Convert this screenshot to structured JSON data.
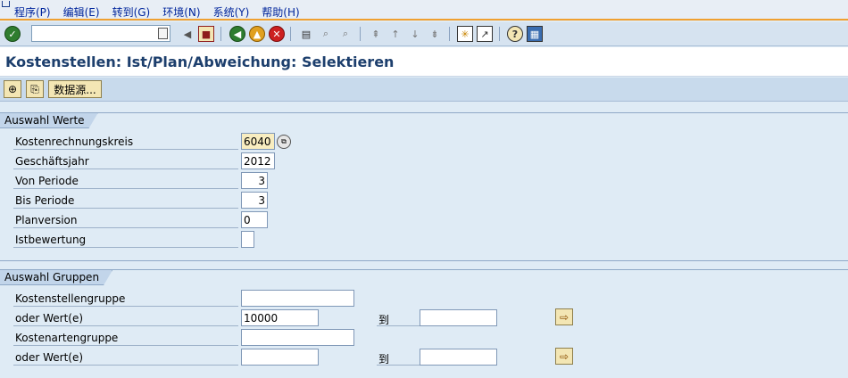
{
  "menu": {
    "items": [
      "程序(P)",
      "编辑(E)",
      "转到(G)",
      "环境(N)",
      "系统(Y)",
      "帮助(H)"
    ]
  },
  "toolbar": {
    "command_field_value": "",
    "icons": [
      "enter-icon",
      "back-triangle-icon",
      "save-icon",
      "back-icon",
      "exit-icon",
      "cancel-icon",
      "print-icon",
      "find-icon",
      "find-next-icon",
      "first-page-icon",
      "previous-page-icon",
      "next-page-icon",
      "last-page-icon",
      "create-session-icon",
      "shortcut-icon",
      "help-icon",
      "layout-menu-icon"
    ]
  },
  "title": "Kostenstellen: Ist/Plan/Abweichung: Selektieren",
  "app_toolbar": {
    "data_source_label": "数据源..."
  },
  "group_values": {
    "title": "Auswahl Werte",
    "rows": [
      {
        "label": "Kostenrechnungskreis",
        "value": "6040"
      },
      {
        "label": "Geschäftsjahr",
        "value": "2012"
      },
      {
        "label": "Von Periode",
        "value": "3"
      },
      {
        "label": "Bis Periode",
        "value": "3"
      },
      {
        "label": "Planversion",
        "value": "0"
      },
      {
        "label": "Istbewertung",
        "value": ""
      }
    ]
  },
  "group_groups": {
    "title": "Auswahl Gruppen",
    "to_label": "到",
    "rows": [
      {
        "label": "Kostenstellengruppe",
        "value": ""
      },
      {
        "label": "oder Wert(e)",
        "value": "10000",
        "to_value": ""
      },
      {
        "label": "Kostenartengruppe",
        "value": ""
      },
      {
        "label": "oder Wert(e)",
        "value": "",
        "to_value": ""
      }
    ]
  },
  "colors": {
    "title_text": "#1d3f6d",
    "menu_accent": "#f0a030",
    "button_face": "#f3e6b4"
  }
}
